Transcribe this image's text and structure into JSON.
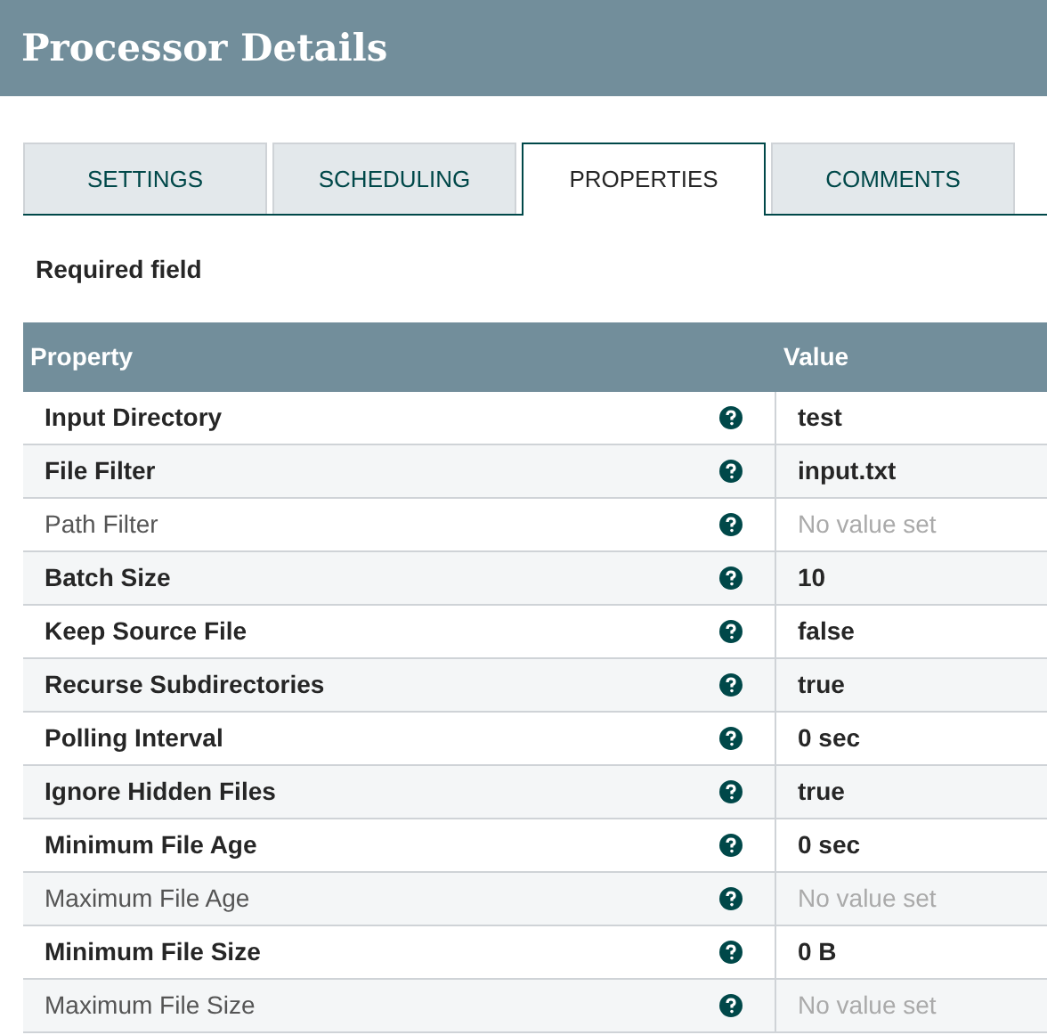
{
  "header": {
    "title": "Processor Details"
  },
  "tabs": [
    {
      "label": "SETTINGS",
      "selected": false
    },
    {
      "label": "SCHEDULING",
      "selected": false
    },
    {
      "label": "PROPERTIES",
      "selected": true
    },
    {
      "label": "COMMENTS",
      "selected": false
    }
  ],
  "required_note": "Required field",
  "table": {
    "columns": [
      "Property",
      "Value"
    ],
    "rows": [
      {
        "property": "Input Directory",
        "required": true,
        "value": "test",
        "value_set": true
      },
      {
        "property": "File Filter",
        "required": true,
        "value": "input.txt",
        "value_set": true
      },
      {
        "property": "Path Filter",
        "required": false,
        "value": "No value set",
        "value_set": false
      },
      {
        "property": "Batch Size",
        "required": true,
        "value": "10",
        "value_set": true
      },
      {
        "property": "Keep Source File",
        "required": true,
        "value": "false",
        "value_set": true
      },
      {
        "property": "Recurse Subdirectories",
        "required": true,
        "value": "true",
        "value_set": true
      },
      {
        "property": "Polling Interval",
        "required": true,
        "value": "0 sec",
        "value_set": true
      },
      {
        "property": "Ignore Hidden Files",
        "required": true,
        "value": "true",
        "value_set": true
      },
      {
        "property": "Minimum File Age",
        "required": true,
        "value": "0 sec",
        "value_set": true
      },
      {
        "property": "Maximum File Age",
        "required": false,
        "value": "No value set",
        "value_set": false
      },
      {
        "property": "Minimum File Size",
        "required": true,
        "value": "0 B",
        "value_set": true
      },
      {
        "property": "Maximum File Size",
        "required": false,
        "value": "No value set",
        "value_set": false
      }
    ]
  }
}
